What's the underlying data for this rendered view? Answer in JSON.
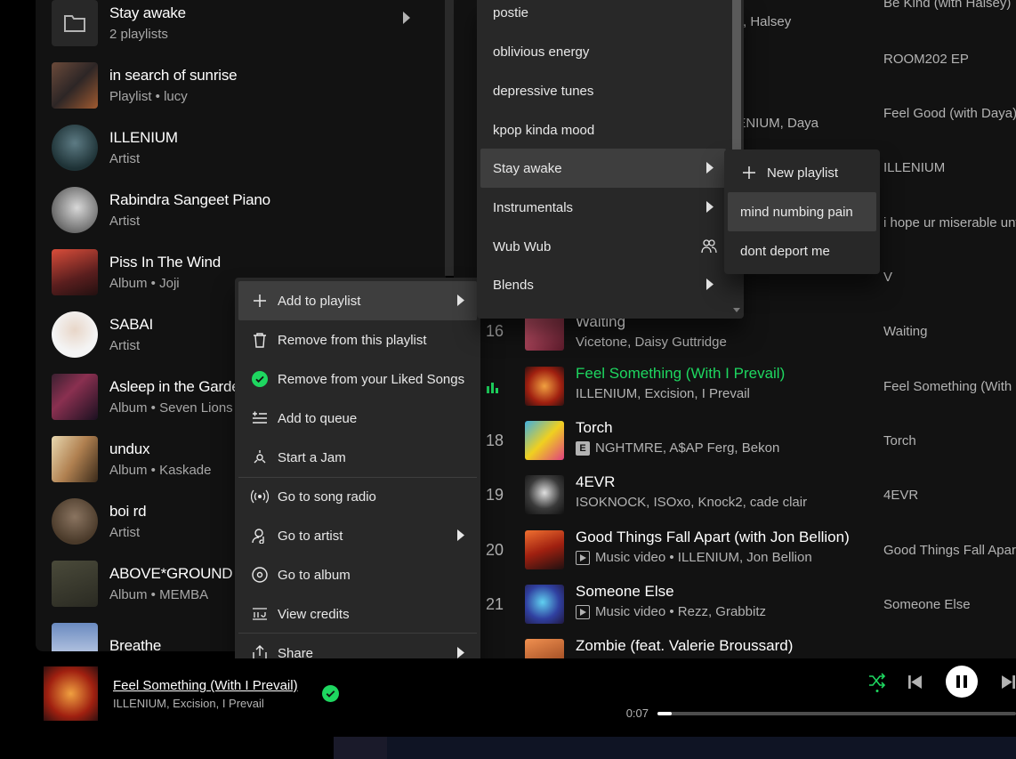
{
  "library": {
    "items": [
      {
        "title": "Stay awake",
        "subtitle": "2 playlists",
        "thumb_icon": "folder-icon"
      },
      {
        "title": "in search of sunrise",
        "subtitle": "Playlist • lucy"
      },
      {
        "title": "ILLENIUM",
        "subtitle": "Artist"
      },
      {
        "title": "Rabindra Sangeet Piano",
        "subtitle": "Artist"
      },
      {
        "title": "Piss In The Wind",
        "subtitle": "Album • Joji"
      },
      {
        "title": "SABAI",
        "subtitle": "Artist"
      },
      {
        "title": "Asleep in the Garden",
        "subtitle": "Album • Seven Lions"
      },
      {
        "title": "undux",
        "subtitle": "Album • Kaskade"
      },
      {
        "title": "boi rd",
        "subtitle": "Artist"
      },
      {
        "title": "ABOVE*GROUND",
        "subtitle": "Album • MEMBA"
      },
      {
        "title": "Breathe",
        "subtitle": ""
      }
    ]
  },
  "tracks": {
    "partial_top": [
      {
        "artist": "llo, Halsey",
        "album": "Be Kind (with Halsey)"
      },
      {
        "artist": "",
        "album": "ROOM202 EP"
      },
      {
        "artist": "LENIUM, Daya",
        "album": "Feel Good (with Daya)"
      },
      {
        "artist": "",
        "album": "ILLENIUM"
      },
      {
        "artist": "",
        "album": "i hope ur miserable until"
      },
      {
        "artist": "",
        "album": "V"
      }
    ],
    "rows": [
      {
        "num": "16",
        "title": "Waiting",
        "artist": "Vicetone, Daisy Guttridge",
        "album": "Waiting",
        "tag": ""
      },
      {
        "num": "",
        "title": "Feel Something (With I Prevail)",
        "artist": "ILLENIUM, Excision, I Prevail",
        "album": "Feel Something (With I Prevail)",
        "tag": "playing"
      },
      {
        "num": "18",
        "title": "Torch",
        "artist": "NGHTMRE, A$AP Ferg, Bekon",
        "album": "Torch",
        "tag": "E"
      },
      {
        "num": "19",
        "title": "4EVR",
        "artist": "ISOKNOCK, ISOxo, Knock2, cade clair",
        "album": "4EVR",
        "tag": ""
      },
      {
        "num": "20",
        "title": "Good Things Fall Apart (with Jon Bellion)",
        "artist": "Music video • ILLENIUM, Jon Bellion",
        "album": "Good Things Fall Apart",
        "tag": "mv"
      },
      {
        "num": "21",
        "title": "Someone Else",
        "artist": "Music video • Rezz, Grabbitz",
        "album": "Someone Else",
        "tag": "mv"
      },
      {
        "num": "",
        "title": "Zombie (feat. Valerie Broussard)",
        "artist": "",
        "album": "",
        "tag": ""
      }
    ]
  },
  "context_menu": {
    "items": [
      {
        "label": "Add to playlist",
        "icon": "plus-icon",
        "submenu": true,
        "highlighted": true
      },
      {
        "label": "Remove from this playlist",
        "icon": "trash-icon"
      },
      {
        "label": "Remove from your Liked Songs",
        "icon": "check-circle-icon"
      },
      {
        "label": "Add to queue",
        "icon": "queue-icon"
      },
      {
        "label": "Start a Jam",
        "icon": "jam-icon"
      },
      {
        "label": "Go to song radio",
        "icon": "radio-icon"
      },
      {
        "label": "Go to artist",
        "icon": "artist-icon",
        "submenu": true
      },
      {
        "label": "Go to album",
        "icon": "album-icon"
      },
      {
        "label": "View credits",
        "icon": "credits-icon"
      },
      {
        "label": "Share",
        "icon": "share-icon",
        "submenu": true
      }
    ]
  },
  "playlist_menu": {
    "items": [
      {
        "label": "postie"
      },
      {
        "label": "oblivious energy"
      },
      {
        "label": "depressive tunes"
      },
      {
        "label": "kpop kinda mood"
      },
      {
        "label": "Stay awake",
        "submenu": true,
        "highlighted": true
      },
      {
        "label": "Instrumentals",
        "submenu": true
      },
      {
        "label": "Wub Wub",
        "collab": true
      },
      {
        "label": "Blends",
        "submenu": true
      }
    ]
  },
  "folder_menu": {
    "items": [
      {
        "label": "New playlist",
        "icon": "plus-icon"
      },
      {
        "label": "mind numbing pain",
        "highlighted": true
      },
      {
        "label": "dont deport me"
      }
    ]
  },
  "player": {
    "title": "Feel Something (With I Prevail)",
    "artist": "ILLENIUM, Excision, I Prevail",
    "elapsed": "0:07",
    "progress": 0.04
  },
  "colors": {
    "accent": "#1ed760",
    "menu_bg": "#282828",
    "highlight": "#3e3e3e"
  }
}
